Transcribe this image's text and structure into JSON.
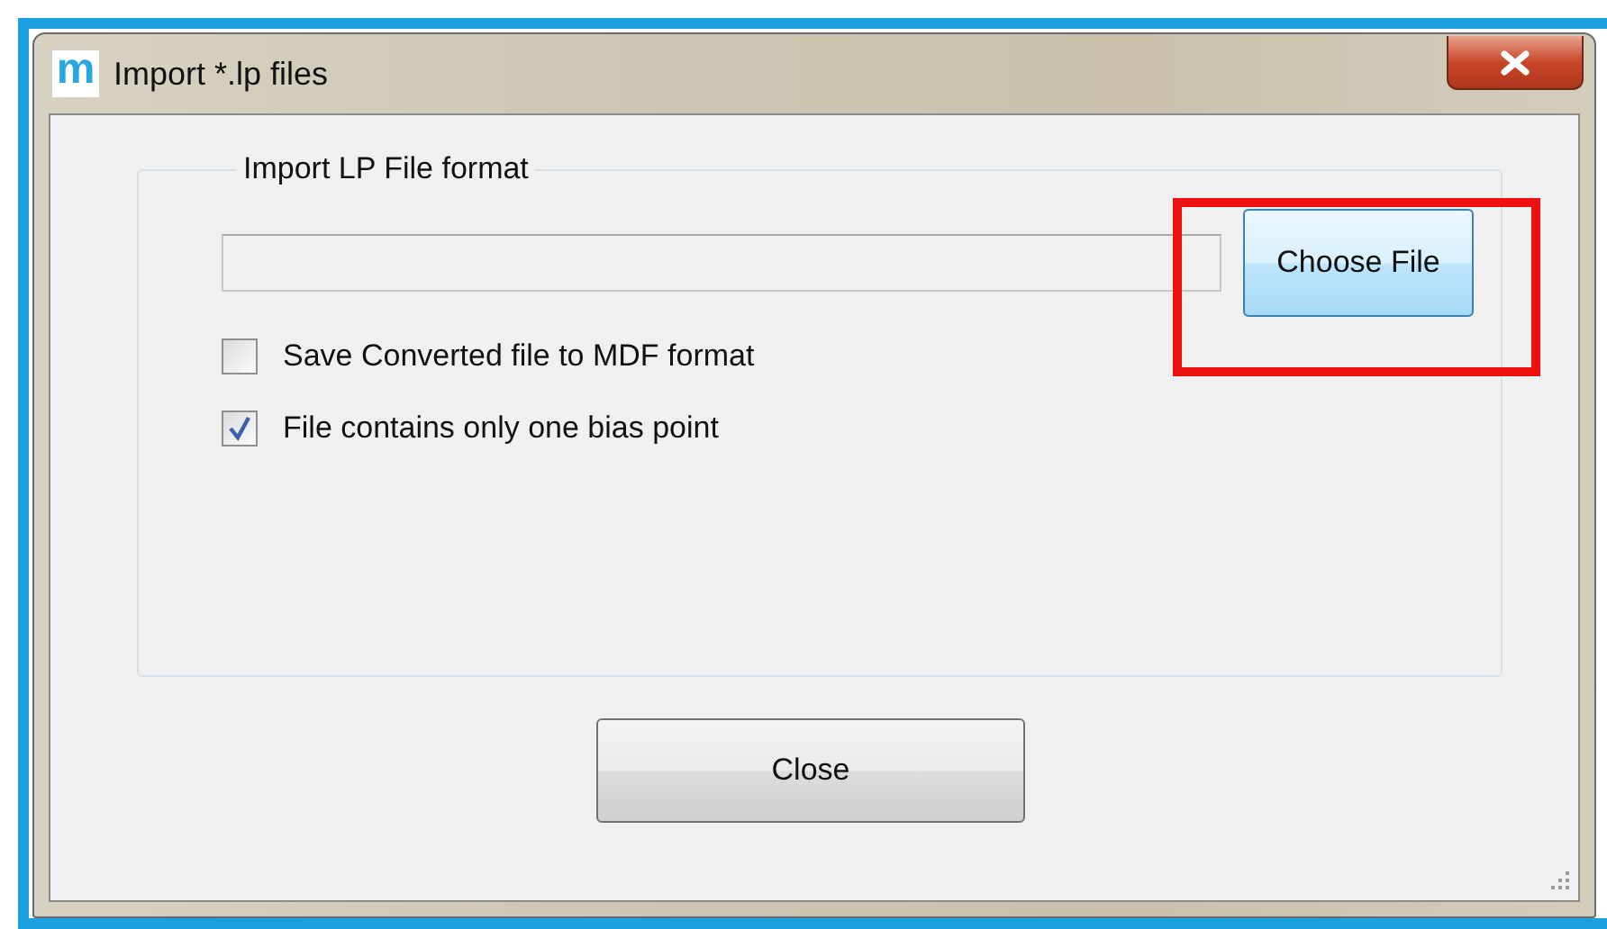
{
  "window": {
    "icon_letter": "m",
    "title": "Import *.lp files"
  },
  "group": {
    "legend": "Import LP File format"
  },
  "choose_button": {
    "label": "Choose File"
  },
  "checkboxes": [
    {
      "label": "Save Converted file to MDF format",
      "checked": false
    },
    {
      "label": "File contains only one bias point",
      "checked": true
    }
  ],
  "close_button": {
    "label": "Close"
  }
}
